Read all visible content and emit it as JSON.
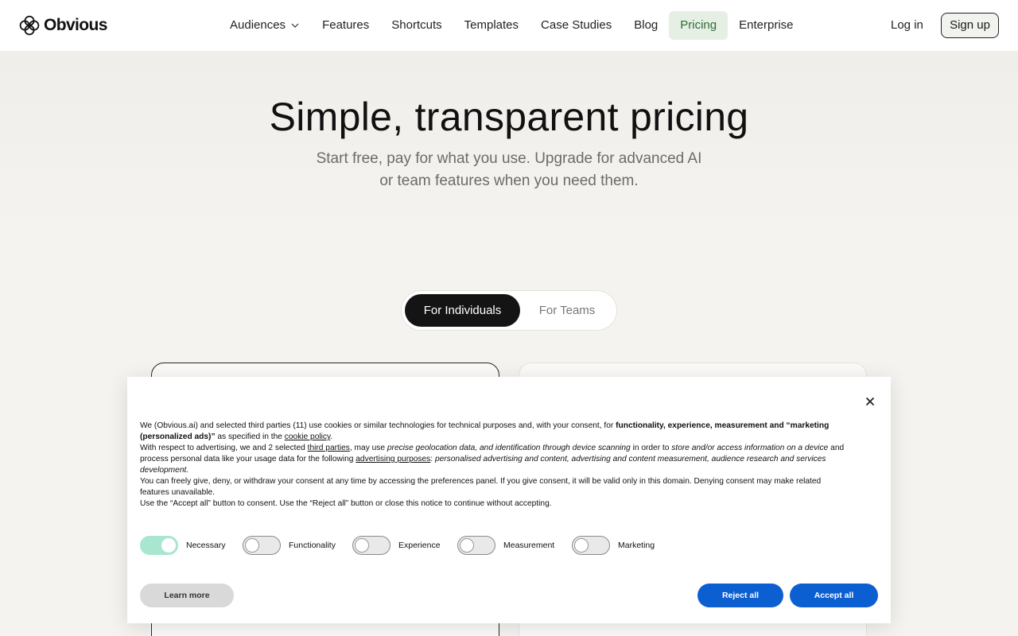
{
  "brand": {
    "name": "Obvious",
    "icon": "flower-logo-icon"
  },
  "nav": {
    "items": [
      {
        "label": "Audiences",
        "has_dropdown": true
      },
      {
        "label": "Features"
      },
      {
        "label": "Shortcuts"
      },
      {
        "label": "Templates"
      },
      {
        "label": "Case Studies"
      },
      {
        "label": "Blog"
      },
      {
        "label": "Pricing",
        "active": true
      },
      {
        "label": "Enterprise"
      }
    ],
    "login": "Log in",
    "signup": "Sign up"
  },
  "hero": {
    "title": "Simple, transparent pricing",
    "subtitle_line1": "Start free, pay for what you use. Upgrade for advanced AI",
    "subtitle_line2": "or team features when you need them."
  },
  "plan_toggle": {
    "selected": "For Individuals",
    "other": "For Teams"
  },
  "cookie": {
    "p1_a": "We (Obvious.ai) and selected third parties (11) use cookies or similar technologies for technical purposes and, with your consent, for ",
    "p1_bold": "functionality, experience, measurement and “marketing (personalized ads)”",
    "p1_b": " as specified in the ",
    "p1_link": "cookie policy",
    "p1_c": ".",
    "p2_a": "With respect to advertising, we and 2 selected ",
    "p2_link": "third parties",
    "p2_b": ", may use ",
    "p2_ital1": "precise geolocation data, and identification through device scanning",
    "p2_c": " in order to ",
    "p2_ital2": "store and/or access information on a device",
    "p2_d": " and process personal data like your usage data for the following ",
    "p2_link2": "advertising purposes",
    "p2_e": ": ",
    "p2_ital3": "personalised advertising and content, advertising and content measurement, audience research and services development.",
    "p3": "You can freely give, deny, or withdraw your consent at any time by accessing the preferences panel. If you give consent, it will be valid only in this domain. Denying consent may make related features unavailable.",
    "p4": "Use the “Accept all” button to consent. Use the “Reject all” button or close this notice to continue without accepting.",
    "toggles": [
      {
        "label": "Necessary",
        "on": true
      },
      {
        "label": "Functionality",
        "on": false
      },
      {
        "label": "Experience",
        "on": false
      },
      {
        "label": "Measurement",
        "on": false
      },
      {
        "label": "Marketing",
        "on": false
      }
    ],
    "learn_more": "Learn more",
    "reject_all": "Reject all",
    "accept_all": "Accept all",
    "colors": {
      "primary": "#0c5fd0",
      "toggle_on": "#a8e6cf"
    }
  }
}
